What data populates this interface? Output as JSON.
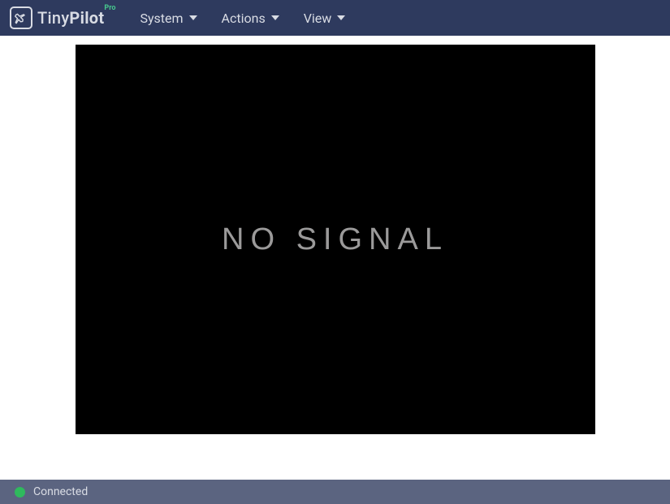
{
  "header": {
    "brand": {
      "text_light": "Tiny",
      "text_bold": "Pilot",
      "badge": "Pro"
    },
    "nav": [
      {
        "label": "System"
      },
      {
        "label": "Actions"
      },
      {
        "label": "View"
      }
    ]
  },
  "main": {
    "video_placeholder": "NO SIGNAL"
  },
  "status": {
    "text": "Connected",
    "dot_color": "#2fba5d"
  }
}
